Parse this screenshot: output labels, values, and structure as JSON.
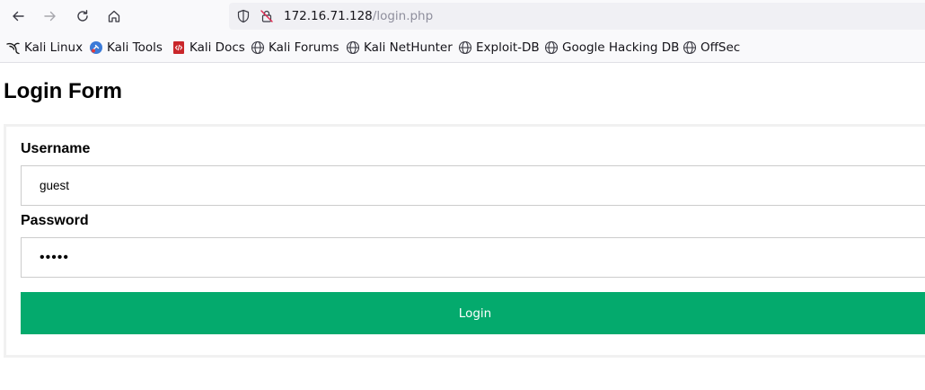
{
  "browser": {
    "url_host": "172.16.71.128",
    "url_path": "/login.php"
  },
  "bookmarks": [
    {
      "label": "Kali Linux",
      "icon": "kali-dragon-icon"
    },
    {
      "label": "Kali Tools",
      "icon": "kali-tools-icon"
    },
    {
      "label": "Kali Docs",
      "icon": "kali-docs-icon"
    },
    {
      "label": "Kali Forums",
      "icon": "globe-icon"
    },
    {
      "label": "Kali NetHunter",
      "icon": "globe-icon"
    },
    {
      "label": "Exploit-DB",
      "icon": "globe-icon"
    },
    {
      "label": "Google Hacking DB",
      "icon": "globe-icon"
    },
    {
      "label": "OffSec",
      "icon": "globe-icon"
    }
  ],
  "page": {
    "title": "Login Form",
    "username_label": "Username",
    "username_value": "guest",
    "password_label": "Password",
    "password_value": "•••••",
    "login_label": "Login"
  },
  "colors": {
    "button": "#04aa6d",
    "button_text": "#ffffff"
  }
}
